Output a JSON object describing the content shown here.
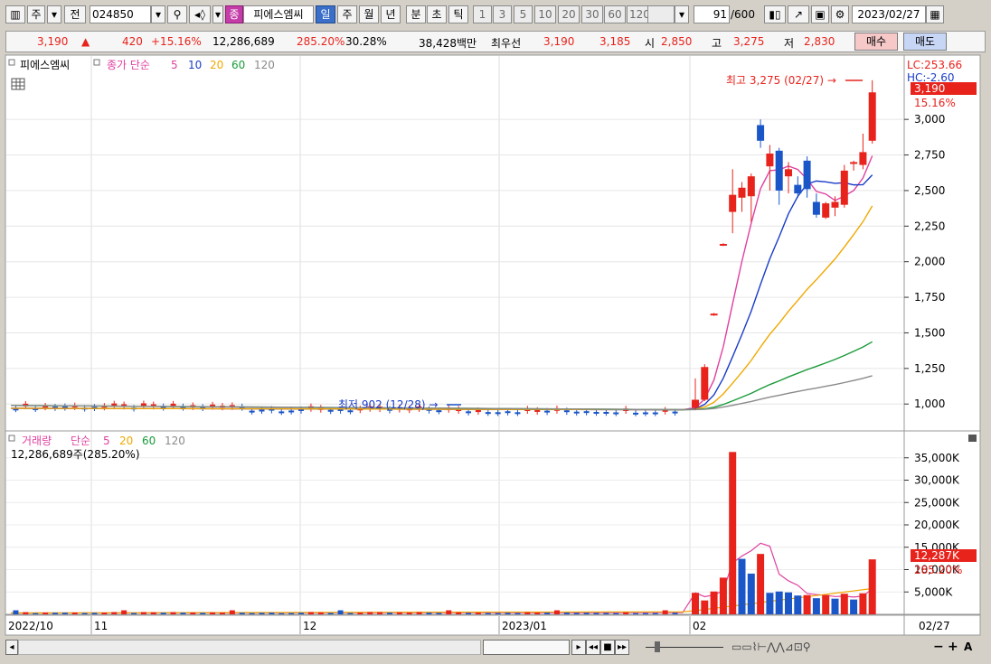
{
  "toolbar": {
    "period_main": "주",
    "prev_label": "전",
    "code": "024850",
    "badge": "종",
    "stock_name": "피에스엠씨",
    "periods": [
      "일",
      "주",
      "월",
      "년",
      "분",
      "초",
      "틱"
    ],
    "active_period": "일",
    "intervals": [
      "1",
      "3",
      "5",
      "10",
      "20",
      "30",
      "60",
      "120"
    ],
    "count_current": "91",
    "count_total": "/600",
    "date": "2023/02/27"
  },
  "quote": {
    "price": "3,190",
    "direction": "▲",
    "change": "420",
    "change_pct": "+15.16%",
    "volume": "12,286,689",
    "volume_ratio": "285.20%",
    "turnover": "30.28%",
    "amount": "38,428백만",
    "best_label": "최우선",
    "best_ask": "3,190",
    "best_bid": "3,185",
    "open_label": "시",
    "open": "2,850",
    "high_label": "고",
    "high": "3,275",
    "low_label": "저",
    "low": "2,830",
    "buy_label": "매수",
    "sell_label": "매도"
  },
  "price_panel": {
    "stock_label": "피에스엠씨",
    "ma_label": "종가 단순",
    "ma_periods": [
      "5",
      "10",
      "20",
      "60",
      "120"
    ],
    "ma_colors": [
      "#e040a0",
      "#1a3cc8",
      "#f0a800",
      "#1a9a3a",
      "#8a8a8a"
    ],
    "lc_label": "LC:253.66",
    "hc_label": "HC:-2.60",
    "last_price_tag": "3,190",
    "last_pct_tag": "15.16%",
    "high_note": "최고 3,275 (02/27) →",
    "low_note": "최저 902 (12/28) →",
    "y_ticks": [
      "3,000",
      "2,750",
      "2,500",
      "2,250",
      "2,000",
      "1,750",
      "1,500",
      "1,250",
      "1,000"
    ]
  },
  "volume_panel": {
    "title": "거래량",
    "ma_label": "단순",
    "ma_periods": [
      "5",
      "20",
      "60",
      "120"
    ],
    "summary": "12,286,689주(285.20%)",
    "y_ticks": [
      "35,000K",
      "30,000K",
      "25,000K",
      "20,000K",
      "15,000K",
      "10,000K",
      "5,000K"
    ],
    "last_tag": "12,287K",
    "last_pct_tag": "285.20%"
  },
  "xaxis": {
    "labels": [
      "2022/10",
      "11",
      "12",
      "2023/01",
      "02"
    ],
    "right_label": "02/27"
  },
  "colors": {
    "up": "#e8231c",
    "down": "#1a56c8",
    "bg": "#ffffff",
    "grid": "#dcdcdc"
  },
  "chart_data": {
    "type": "candlestick",
    "ylim": [
      830,
      3420
    ],
    "volume_ylim": [
      0,
      40000
    ],
    "candles": [
      {
        "date": "02/01",
        "o": 975,
        "h": 1180,
        "l": 960,
        "c": 1030
      },
      {
        "date": "02/02",
        "o": 1030,
        "h": 1280,
        "l": 1020,
        "c": 1260
      },
      {
        "date": "02/03",
        "o": 1630,
        "h": 1640,
        "l": 1620,
        "c": 1635
      },
      {
        "date": "02/06",
        "o": 2120,
        "h": 2130,
        "l": 2110,
        "c": 2125
      },
      {
        "date": "02/07",
        "o": 2350,
        "h": 2650,
        "l": 2200,
        "c": 2470
      },
      {
        "date": "02/08",
        "o": 2450,
        "h": 2560,
        "l": 2350,
        "c": 2520
      },
      {
        "date": "02/09",
        "o": 2460,
        "h": 2620,
        "l": 2280,
        "c": 2600
      },
      {
        "date": "02/10",
        "o": 2960,
        "h": 3000,
        "l": 2800,
        "c": 2850
      },
      {
        "date": "02/13",
        "o": 2670,
        "h": 2820,
        "l": 2500,
        "c": 2760
      },
      {
        "date": "02/14",
        "o": 2780,
        "h": 2800,
        "l": 2400,
        "c": 2500
      },
      {
        "date": "02/15",
        "o": 2600,
        "h": 2700,
        "l": 2480,
        "c": 2650
      },
      {
        "date": "02/16",
        "o": 2540,
        "h": 2600,
        "l": 2450,
        "c": 2480
      },
      {
        "date": "02/17",
        "o": 2710,
        "h": 2740,
        "l": 2450,
        "c": 2510
      },
      {
        "date": "02/20",
        "o": 2420,
        "h": 2480,
        "l": 2310,
        "c": 2330
      },
      {
        "date": "02/21",
        "o": 2310,
        "h": 2420,
        "l": 2300,
        "c": 2410
      },
      {
        "date": "02/22",
        "o": 2380,
        "h": 2460,
        "l": 2320,
        "c": 2420
      },
      {
        "date": "02/23",
        "o": 2400,
        "h": 2680,
        "l": 2380,
        "c": 2640
      },
      {
        "date": "02/24",
        "o": 2690,
        "h": 2710,
        "l": 2640,
        "c": 2700
      },
      {
        "date": "02/24b",
        "o": 2680,
        "h": 2900,
        "l": 2650,
        "c": 2770
      },
      {
        "date": "02/27",
        "o": 2850,
        "h": 3275,
        "l": 2830,
        "c": 3190
      }
    ],
    "volumes": [
      {
        "date": "02/01",
        "v": 4800,
        "up": true
      },
      {
        "date": "02/02",
        "v": 3100,
        "up": true
      },
      {
        "date": "02/03",
        "v": 5100,
        "up": true
      },
      {
        "date": "02/06",
        "v": 8200,
        "up": true
      },
      {
        "date": "02/07",
        "v": 36300,
        "up": true
      },
      {
        "date": "02/08",
        "v": 12400,
        "up": false
      },
      {
        "date": "02/09",
        "v": 9100,
        "up": false
      },
      {
        "date": "02/10",
        "v": 13500,
        "up": true
      },
      {
        "date": "02/13",
        "v": 4800,
        "up": false
      },
      {
        "date": "02/14",
        "v": 5100,
        "up": false
      },
      {
        "date": "02/15",
        "v": 4900,
        "up": false
      },
      {
        "date": "02/16",
        "v": 4200,
        "up": false
      },
      {
        "date": "02/17",
        "v": 4300,
        "up": true
      },
      {
        "date": "02/20",
        "v": 3600,
        "up": false
      },
      {
        "date": "02/21",
        "v": 4300,
        "up": true
      },
      {
        "date": "02/22",
        "v": 3500,
        "up": false
      },
      {
        "date": "02/23",
        "v": 4600,
        "up": true
      },
      {
        "date": "02/24",
        "v": 3300,
        "up": false
      },
      {
        "date": "02/24b",
        "v": 4700,
        "up": true
      },
      {
        "date": "02/27",
        "v": 12287,
        "up": true
      }
    ],
    "early_price_level": 960,
    "low": {
      "value": 902,
      "date": "12/28"
    },
    "high": {
      "value": 3275,
      "date": "02/27"
    }
  }
}
